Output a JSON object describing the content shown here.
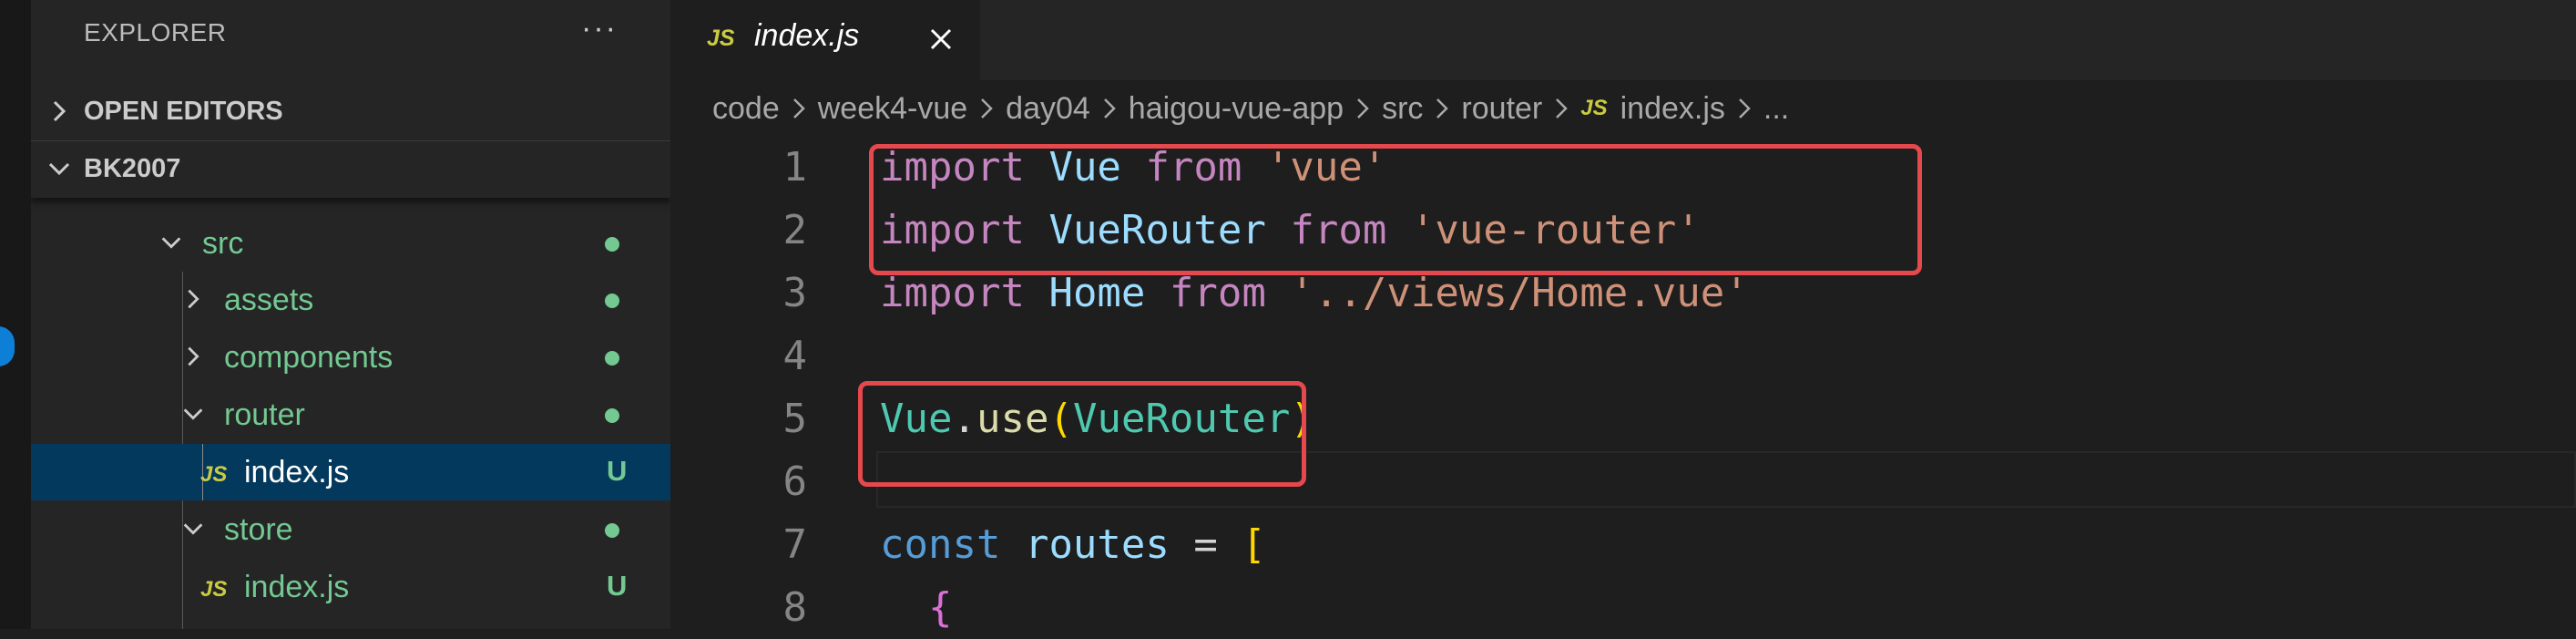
{
  "sidebar": {
    "title": "EXPLORER",
    "more_label": "···",
    "sections": {
      "open_editors": "OPEN EDITORS",
      "workspace": "BK2007"
    },
    "tree": [
      {
        "label": "src",
        "kind": "folder",
        "expanded": true,
        "status": "dot"
      },
      {
        "label": "assets",
        "kind": "folder",
        "expanded": false,
        "status": "dot"
      },
      {
        "label": "components",
        "kind": "folder",
        "expanded": false,
        "status": "dot"
      },
      {
        "label": "router",
        "kind": "folder",
        "expanded": true,
        "status": "dot"
      },
      {
        "label": "index.js",
        "kind": "file",
        "icon": "JS",
        "status": "U",
        "selected": true
      },
      {
        "label": "store",
        "kind": "folder",
        "expanded": true,
        "status": "dot"
      },
      {
        "label": "index.js",
        "kind": "file",
        "icon": "JS",
        "status": "U"
      }
    ]
  },
  "editor": {
    "tab": {
      "icon": "JS",
      "label": "index.js"
    },
    "breadcrumb": [
      "code",
      "week4-vue",
      "day04",
      "haigou-vue-app",
      "src",
      "router",
      "index.js",
      "..."
    ],
    "breadcrumb_icon": "JS",
    "line_numbers": [
      "1",
      "2",
      "3",
      "4",
      "5",
      "6",
      "7",
      "8"
    ],
    "code": {
      "l1": {
        "kw": "import",
        "name": "Vue",
        "from": "from",
        "str": "'vue'"
      },
      "l2": {
        "kw": "import",
        "name": "VueRouter",
        "from": "from",
        "str": "'vue-router'"
      },
      "l3": {
        "kw": "import",
        "name": "Home",
        "from": "from",
        "str": "'../views/Home.vue'"
      },
      "l5": {
        "obj": "Vue",
        "dot": ".",
        "fn": "use",
        "open": "(",
        "arg": "VueRouter",
        "close": ")"
      },
      "l7": {
        "kw": "const",
        "name": "routes",
        "op": "=",
        "open": "["
      },
      "l8": {
        "open": "{"
      }
    }
  },
  "colors": {
    "accent_modified": "#73c991",
    "highlight_box": "#e5484d",
    "js_icon": "#cbcb41",
    "selection": "#04395e"
  }
}
